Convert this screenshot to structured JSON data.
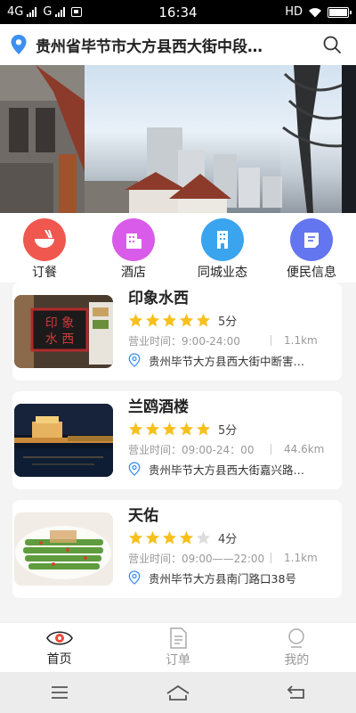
{
  "status_bar": {
    "network1": "4G",
    "network2": "G",
    "time": "16:34",
    "hd": "HD"
  },
  "header": {
    "location": "贵州省毕节市大方县西大街中段…"
  },
  "categories": [
    {
      "label": "订餐",
      "icon": "food-bowl-icon",
      "color": "#f0584f"
    },
    {
      "label": "酒店",
      "icon": "hotel-icon",
      "color": "#d95be9"
    },
    {
      "label": "同城业态",
      "icon": "building-icon",
      "color": "#3aa4ef"
    },
    {
      "label": "便民信息",
      "icon": "message-icon",
      "color": "#6376ef"
    }
  ],
  "restaurants": [
    {
      "name": "印象水西",
      "stars": 5,
      "score": "5分",
      "hours": "营业时间：9:00-24:00",
      "distance": "1.1km",
      "address": "贵州毕节大方县西大街中断害…"
    },
    {
      "name": "兰鸥酒楼",
      "stars": 5,
      "score": "5分",
      "hours": "营业时间：09:00-24：00",
      "distance": "44.6km",
      "address": "贵州毕节大方县西大街嘉兴路…"
    },
    {
      "name": "天佑",
      "stars": 4,
      "score": "4分",
      "hours": "营业时间：09:00——22:00",
      "distance": "1.1km",
      "address": "贵州毕节大方县南门路口38号"
    }
  ],
  "tabs": [
    {
      "label": "首页",
      "active": true
    },
    {
      "label": "订单",
      "active": false
    },
    {
      "label": "我的",
      "active": false
    }
  ],
  "colors": {
    "star_on": "#f7c01d",
    "star_off": "#dddddd",
    "accent_location": "#3d8ff0"
  }
}
